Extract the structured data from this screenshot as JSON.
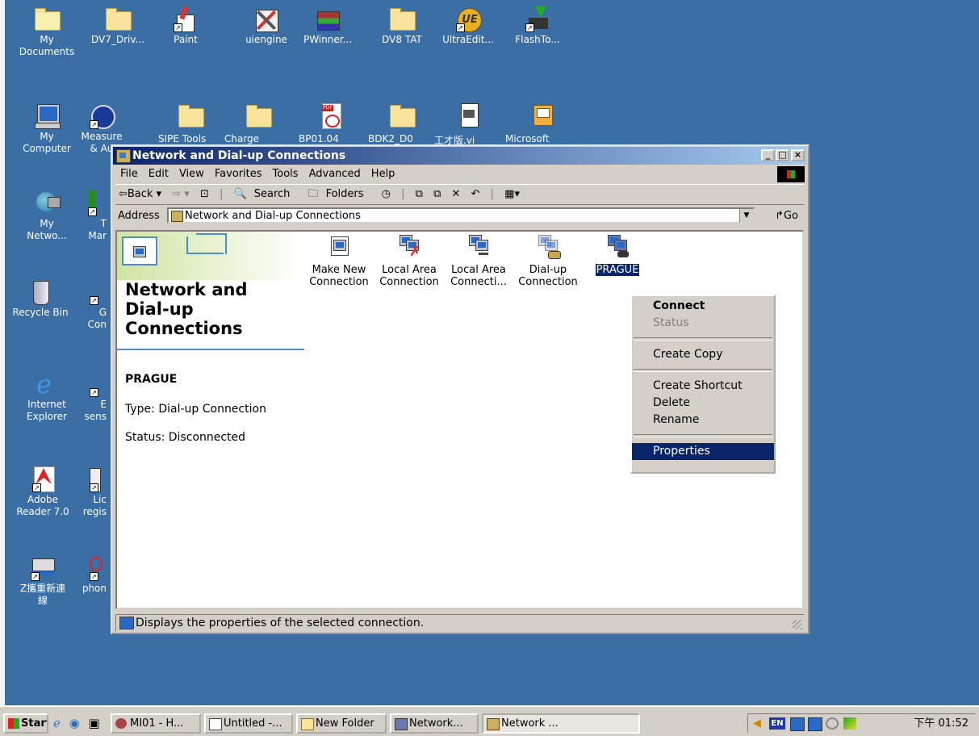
{
  "desktop": {
    "icons": [
      {
        "label": "My\nDocuments",
        "icon": "my-documents-icon"
      },
      {
        "label": "DV7_Driv...",
        "icon": "folder-icon"
      },
      {
        "label": "Paint",
        "icon": "paint-icon"
      },
      {
        "label": "uiengine",
        "icon": "tools-icon"
      },
      {
        "label": "PWinner...",
        "icon": "archive-icon"
      },
      {
        "label": "DV8 TAT",
        "icon": "folder-icon"
      },
      {
        "label": "UltraEdit...",
        "icon": "ultraedit-icon"
      },
      {
        "label": "FlashTo...",
        "icon": "flash-tool-icon"
      },
      {
        "label": "My\nComputer",
        "icon": "my-computer-icon"
      },
      {
        "label": "Measure\n& Au",
        "icon": "measure-icon"
      },
      {
        "label": "SIPE Tools",
        "icon": "folder-icon"
      },
      {
        "label": "Charge",
        "icon": "folder-icon"
      },
      {
        "label": "BP01.04",
        "icon": "pdf-icon"
      },
      {
        "label": "BDK2_D0",
        "icon": "folder-icon"
      },
      {
        "label": "工才版.vi",
        "icon": "file-icon"
      },
      {
        "label": "Microsoft",
        "icon": "microsoft-icon"
      },
      {
        "label": "My\nNetwo...",
        "icon": "my-network-icon"
      },
      {
        "label": "T\nMar",
        "icon": "shortcut-icon"
      },
      {
        "label": "Recycle Bin",
        "icon": "recycle-bin-icon"
      },
      {
        "label": "G\nCon",
        "icon": "shortcut-icon"
      },
      {
        "label": "Internet\nExplorer",
        "icon": "internet-explorer-icon"
      },
      {
        "label": "E\nsens",
        "icon": "shortcut-icon"
      },
      {
        "label": "Adobe\nReader 7.0",
        "icon": "adobe-reader-icon"
      },
      {
        "label": "Lic\nregis",
        "icon": "shortcut-icon"
      },
      {
        "label": "Z攜重新連\n線",
        "icon": "network-shortcut-icon"
      },
      {
        "label": "phon",
        "icon": "shortcut-icon"
      }
    ]
  },
  "window": {
    "title": "Network and Dial-up Connections",
    "controls": {
      "minimize": "_",
      "maximize": "□",
      "close": "×"
    },
    "menu": [
      "File",
      "Edit",
      "View",
      "Favorites",
      "Tools",
      "Advanced",
      "Help"
    ],
    "toolbar": {
      "back": "⇦Back ▾",
      "forward": "⇨ ▾",
      "up": "⊡",
      "search": "Search",
      "folders": "Folders",
      "history": "◷",
      "view": "▦▾"
    },
    "address": {
      "label": "Address",
      "value": "Network and Dial-up Connections",
      "go": "Go"
    },
    "left_pane": {
      "title": "Network and Dial-up Connections",
      "selected_name": "PRAGUE",
      "type": "Type: Dial-up Connection",
      "status": "Status: Disconnected"
    },
    "items": [
      {
        "label": "Make New Connection",
        "icon": "make-new-connection-icon"
      },
      {
        "label": "Local Area Connection",
        "icon": "local-area-connection-disabled-icon"
      },
      {
        "label": "Local Area Connecti...",
        "icon": "local-area-connection-icon"
      },
      {
        "label": "Dial-up Connection",
        "icon": "dial-up-connection-icon"
      },
      {
        "label": "PRAGUE",
        "icon": "prague-connection-icon",
        "selected": true
      }
    ],
    "status_bar": "Displays the properties of the selected connection."
  },
  "context_menu": {
    "items": [
      {
        "label": "Connect",
        "bold": true
      },
      {
        "label": "Status",
        "disabled": true
      },
      {
        "separator": true
      },
      {
        "label": "Create Copy"
      },
      {
        "separator": true
      },
      {
        "label": "Create Shortcut"
      },
      {
        "label": "Delete"
      },
      {
        "label": "Rename"
      },
      {
        "separator": true
      },
      {
        "label": "Properties",
        "highlighted": true
      }
    ]
  },
  "taskbar": {
    "start": "Start",
    "buttons": [
      "MI01 - H...",
      "Untitled -...",
      "New Folder",
      "Network...",
      "Network ..."
    ],
    "tray_lang": "EN",
    "clock": "下午 01:52"
  },
  "colors": {
    "desktop": "#3a6ea5",
    "title_active": "#0a246a",
    "highlight": "#0a246a",
    "face": "#d4d0c8"
  }
}
